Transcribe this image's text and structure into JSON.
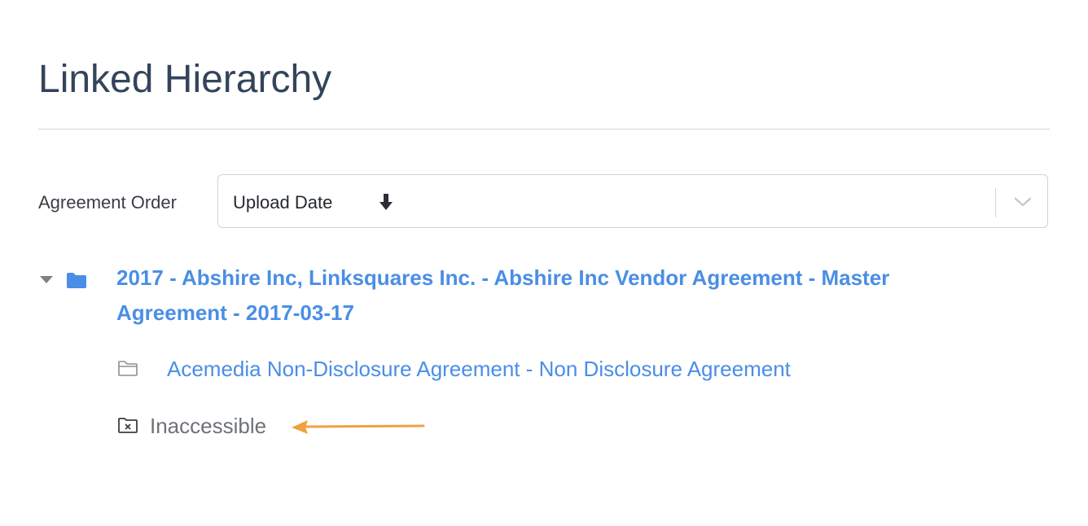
{
  "page": {
    "title": "Linked Hierarchy"
  },
  "order": {
    "label": "Agreement Order",
    "selected": "Upload Date",
    "sort_direction_icon": "arrow-down-icon",
    "dropdown_icon": "chevron-down-icon"
  },
  "hierarchy": {
    "master": {
      "icon": "folder-filled-icon",
      "expand_icon": "caret-down-icon",
      "title": "2017 - Abshire Inc, Linksquares Inc. - Abshire Inc Vendor Agreement - Master Agreement - 2017-03-17"
    },
    "children": [
      {
        "icon": "folder-outline-icon",
        "title": "Acemedia Non-Disclosure Agreement - Non Disclosure Agreement"
      },
      {
        "icon": "folder-x-icon",
        "title": "Inaccessible"
      }
    ]
  },
  "annotation": {
    "icon": "arrow-left-icon",
    "color": "#f0a040"
  },
  "colors": {
    "link": "#4a8ee6",
    "title": "#34445a",
    "muted": "#6d7278"
  }
}
